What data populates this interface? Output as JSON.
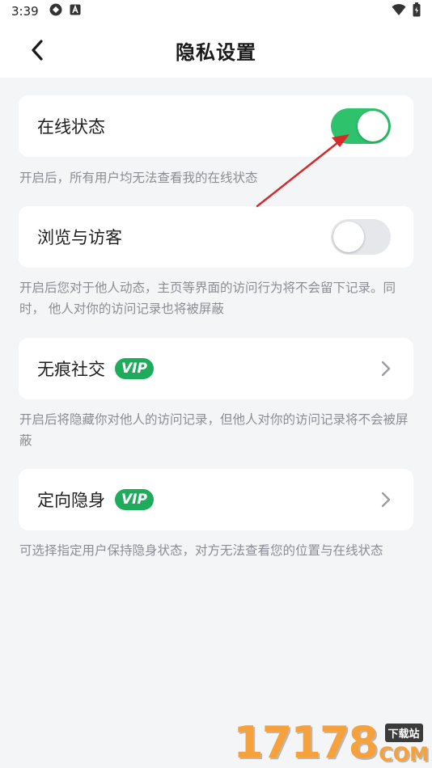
{
  "status_bar": {
    "time": "3:39",
    "left_icons": [
      "sync-icon",
      "a-badge-icon"
    ],
    "right_icons": [
      "wifi-icon",
      "battery-icon"
    ]
  },
  "header": {
    "title": "隐私设置",
    "back_icon": "chevron-left-icon"
  },
  "settings": [
    {
      "label": "在线状态",
      "control": "toggle",
      "enabled": true,
      "description": "开启后，所有用户均无法查看我的在线状态"
    },
    {
      "label": "浏览与访客",
      "control": "toggle",
      "enabled": false,
      "description": "开启后您对于他人动态，主页等界面的访问行为将不会留下记录。同时， 他人对你的访问记录也将被屏蔽"
    },
    {
      "label": "无痕社交",
      "control": "chevron",
      "badge": "VIP",
      "description": "开启后将隐藏你对他人的访问记录，但他人对你的访问记录将不会被屏蔽"
    },
    {
      "label": "定向隐身",
      "control": "chevron",
      "badge": "VIP",
      "description": "可选择指定用户保持隐身状态，对方无法查看您的位置与在线状态"
    }
  ],
  "colors": {
    "toggle_on": "#2dc26b",
    "toggle_off": "#e6e7ea",
    "vip_badge": "#1fab5c",
    "annotation_arrow": "#d62a2a",
    "watermark": "#f6a13c"
  },
  "watermark": {
    "digits": "17178",
    "tag": "下载站",
    "suffix": "COM"
  }
}
